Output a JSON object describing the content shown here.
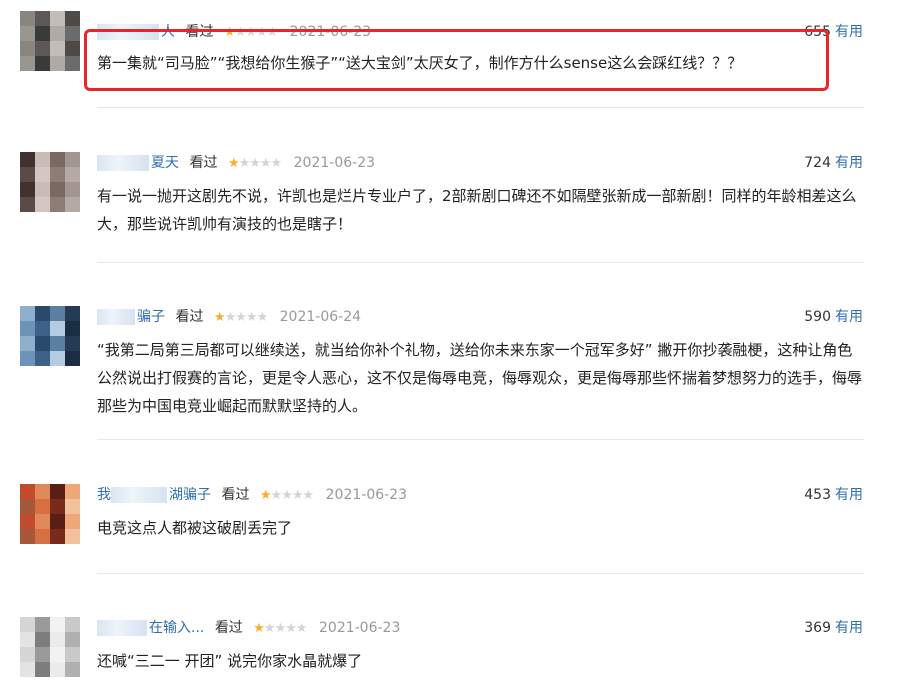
{
  "reviews": [
    {
      "username": "人",
      "watched": "看过",
      "rating": 1,
      "date": "2021-06-23",
      "useful_count": "655",
      "useful_label": "有用",
      "content": "第一集就“司马脸”“我想给你生猴子”“送大宝剑”太厌女了，制作方什么sense这么会踩红线？？？",
      "highlighted": true
    },
    {
      "username": "夏天",
      "watched": "看过",
      "rating": 1,
      "date": "2021-06-23",
      "useful_count": "724",
      "useful_label": "有用",
      "content": "有一说一抛开这剧先不说，许凯也是烂片专业户了，2部新剧口碑还不如隔壁张新成一部新剧！同样的年龄相差这么大，那些说许凯帅有演技的也是瞎子！"
    },
    {
      "username": "骗子",
      "watched": "看过",
      "rating": 1,
      "date": "2021-06-24",
      "useful_count": "590",
      "useful_label": "有用",
      "content": "“我第二局第三局都可以继续送，就当给你补个礼物，送给你未来东家一个冠军多好” 撇开你抄袭融梗，这种让角色公然说出打假赛的言论，更是令人恶心，这不仅是侮辱电竞，侮辱观众，更是侮辱那些怀揣着梦想努力的选手，侮辱那些为中国电竞业崛起而默默坚持的人。"
    },
    {
      "username_prefix": "我",
      "username": "湖骗子",
      "watched": "看过",
      "rating": 1,
      "date": "2021-06-23",
      "useful_count": "453",
      "useful_label": "有用",
      "content": "电竞这点人都被这破剧丢完了"
    },
    {
      "username": "在输入...",
      "watched": "看过",
      "rating": 1,
      "date": "2021-06-23",
      "useful_count": "369",
      "useful_label": "有用",
      "content": "还喊“三二一 开团” 说完你家水晶就爆了"
    }
  ],
  "colors": {
    "username": "#2f6fb3",
    "star_on": "#ffac2d",
    "star_off": "#d4d4d4",
    "highlight_border": "#e8262a"
  }
}
